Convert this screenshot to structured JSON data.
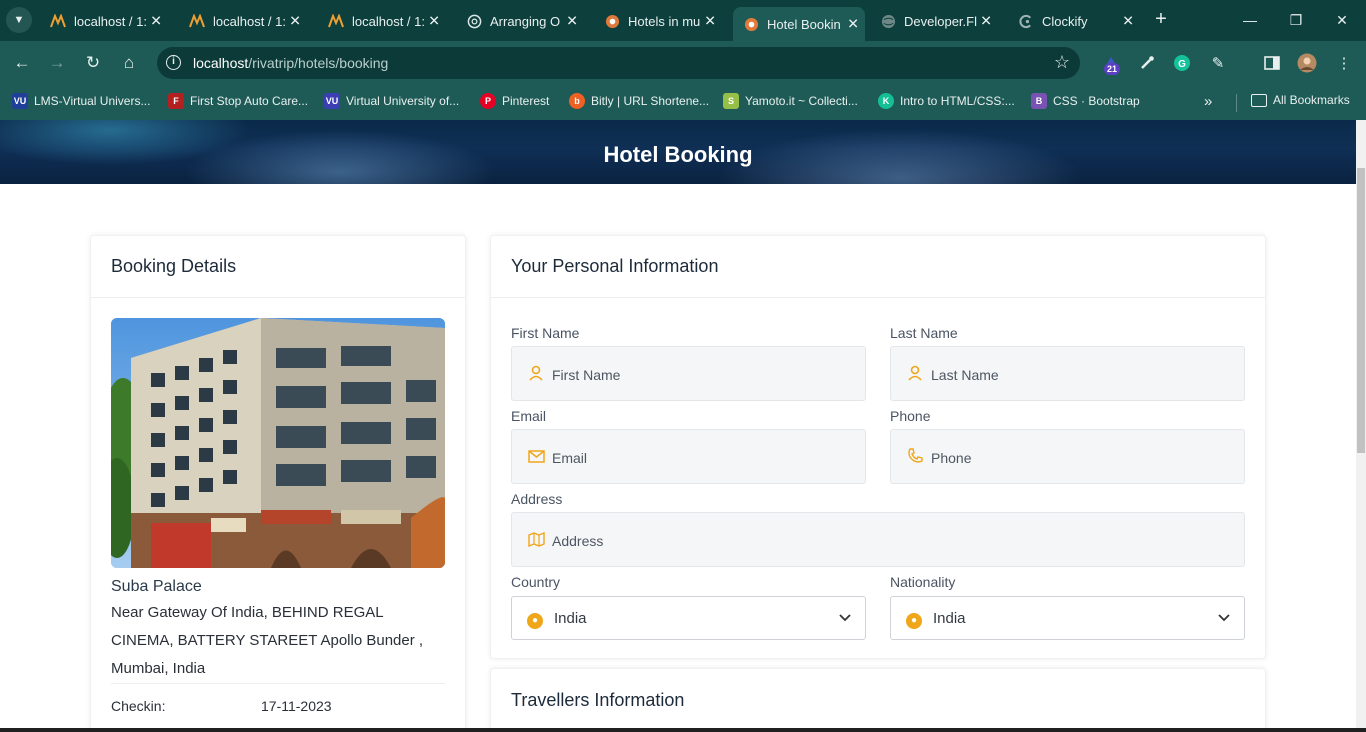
{
  "browser": {
    "tabs": [
      {
        "title": "localhost / 1:",
        "icon": "phpmyadmin-icon",
        "active": false
      },
      {
        "title": "localhost / 1:",
        "icon": "phpmyadmin-icon",
        "active": false
      },
      {
        "title": "localhost / 1:",
        "icon": "phpmyadmin-icon",
        "active": false
      },
      {
        "title": "Arranging O",
        "icon": "chatgpt-icon",
        "active": false
      },
      {
        "title": "Hotels in mu",
        "icon": "rivatrip-icon",
        "active": false
      },
      {
        "title": "Hotel Bookin",
        "icon": "rivatrip-icon",
        "active": true
      },
      {
        "title": "Developer.Fl",
        "icon": "globe-icon",
        "active": false
      },
      {
        "title": "Clockify",
        "icon": "clockify-icon",
        "active": false
      }
    ],
    "url_host": "localhost",
    "url_path": "/rivatrip/hotels/booking",
    "extension_badge": "21",
    "bookmarks": [
      {
        "label": "LMS-Virtual Univers...",
        "icon": "vu-icon",
        "color": "#1f3f99"
      },
      {
        "label": "First Stop Auto Care...",
        "icon": "auto-care-icon",
        "color": "#b32020"
      },
      {
        "label": "Virtual University of...",
        "icon": "vu-icon",
        "color": "#3b3fb3"
      },
      {
        "label": "Pinterest",
        "icon": "pinterest-icon",
        "color": "#e60023"
      },
      {
        "label": "Bitly | URL Shortene...",
        "icon": "bitly-icon",
        "color": "#ee6123"
      },
      {
        "label": "Yamoto.it ~ Collecti...",
        "icon": "shopify-icon",
        "color": "#95bf47"
      },
      {
        "label": "Intro to HTML/CSS:...",
        "icon": "khan-academy-icon",
        "color": "#14bf96"
      },
      {
        "label": "CSS · Bootstrap",
        "icon": "bootstrap-icon",
        "color": "#7952b3"
      }
    ],
    "all_bookmarks": "All Bookmarks"
  },
  "page": {
    "hero_title": "Hotel Booking",
    "booking_details": {
      "heading": "Booking Details",
      "hotel_name": "Suba Palace",
      "hotel_address": "Near Gateway Of India, BEHIND REGAL CINEMA, BATTERY STAREET Apollo Bunder , Mumbai, India",
      "checkin_label": "Checkin:",
      "checkin_value": "17-11-2023"
    },
    "personal_info": {
      "heading": "Your Personal Information",
      "first_name_label": "First Name",
      "first_name_placeholder": "First Name",
      "last_name_label": "Last Name",
      "last_name_placeholder": "Last Name",
      "email_label": "Email",
      "email_placeholder": "Email",
      "phone_label": "Phone",
      "phone_placeholder": "Phone",
      "address_label": "Address",
      "address_placeholder": "Address",
      "country_label": "Country",
      "country_value": "India",
      "nationality_label": "Nationality",
      "nationality_value": "India"
    },
    "travellers_info": {
      "heading": "Travellers Information"
    },
    "accent_color": "#f0a619"
  }
}
